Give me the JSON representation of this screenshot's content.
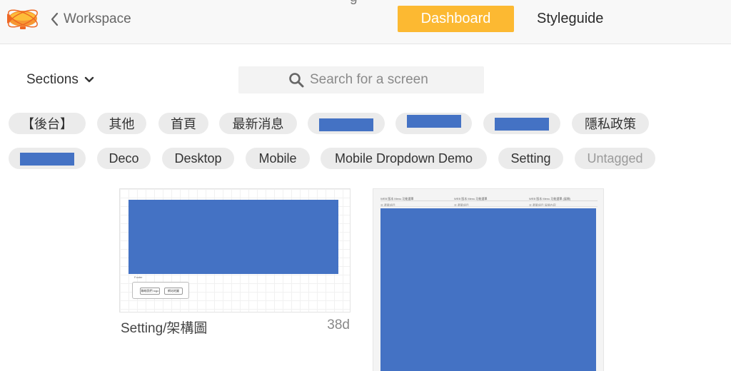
{
  "header": {
    "back_label": "Workspace",
    "title_partial": "g",
    "nav": {
      "dashboard": "Dashboard",
      "styleguide": "Styleguide"
    },
    "accent_color": "#fcb932"
  },
  "toolbar": {
    "sections_label": "Sections",
    "search_placeholder": "Search for a screen"
  },
  "tags": {
    "row1": [
      "【後台】",
      "其他",
      "首頁",
      "最新消息",
      "",
      "",
      "",
      "隱私政策"
    ],
    "row2": [
      "",
      "Deco",
      "Desktop",
      "Mobile",
      "Mobile Dropdown Demo",
      "Setting",
      "Untagged"
    ]
  },
  "screens": [
    {
      "title": "Setting/架構圖",
      "age": "38d",
      "footer_label": "Footer",
      "footer_buttons": [
        "聯絡我們 logo",
        "網站地圖"
      ]
    },
    {
      "title": "",
      "age": "",
      "columns": [
        {
          "heading": "WEB 版本 Menu 功能選單",
          "sub": "☰ 選單項目"
        },
        {
          "heading": "WEB 版本 Menu 功能選單",
          "sub": "☰ 選單項目"
        },
        {
          "heading": "WEB 版本 Menu 功能選單 (展開)",
          "sub": "☰ 選單項目 展開內容"
        }
      ]
    }
  ],
  "colors": {
    "redaction": "#4472c4",
    "tag_background": "#ebebeb",
    "header_background": "#f8f8f8"
  }
}
